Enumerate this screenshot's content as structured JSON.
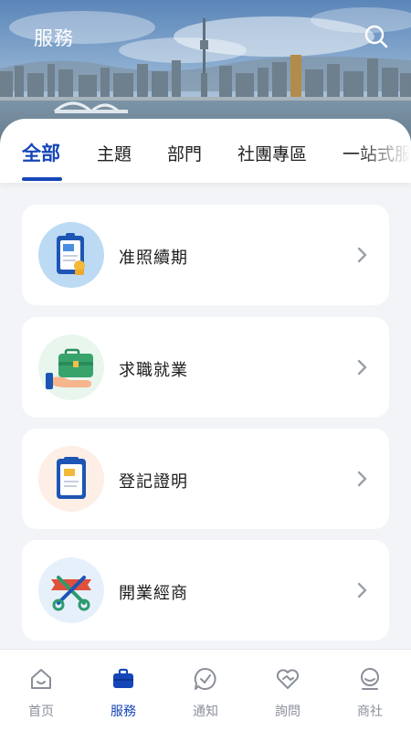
{
  "header": {
    "title": "服務",
    "search_icon": "search-icon"
  },
  "tabs": [
    {
      "label": "全部",
      "active": true
    },
    {
      "label": "主題",
      "active": false
    },
    {
      "label": "部門",
      "active": false
    },
    {
      "label": "社團專區",
      "active": false
    },
    {
      "label": "一站式服",
      "active": false
    }
  ],
  "services": [
    {
      "label": "准照續期",
      "icon": "license-certificate-icon",
      "icon_bg": "#bcdaf3"
    },
    {
      "label": "求職就業",
      "icon": "briefcase-hand-icon",
      "icon_bg": "#e9f6ee"
    },
    {
      "label": "登記證明",
      "icon": "clipboard-document-icon",
      "icon_bg": "#fdeee6"
    },
    {
      "label": "開業經商",
      "icon": "ribbon-scissors-icon",
      "icon_bg": "#e6f0fb"
    }
  ],
  "bottom_nav": [
    {
      "label": "首页",
      "icon": "home-icon",
      "active": false
    },
    {
      "label": "服務",
      "icon": "briefcase-icon",
      "active": true
    },
    {
      "label": "通知",
      "icon": "chat-check-icon",
      "active": false
    },
    {
      "label": "詢問",
      "icon": "heart-handshake-icon",
      "active": false
    },
    {
      "label": "商社",
      "icon": "user-chat-icon",
      "active": false
    }
  ],
  "colors": {
    "accent": "#1546b8",
    "inactive": "#8a8f99",
    "background": "#f2f4f7"
  }
}
